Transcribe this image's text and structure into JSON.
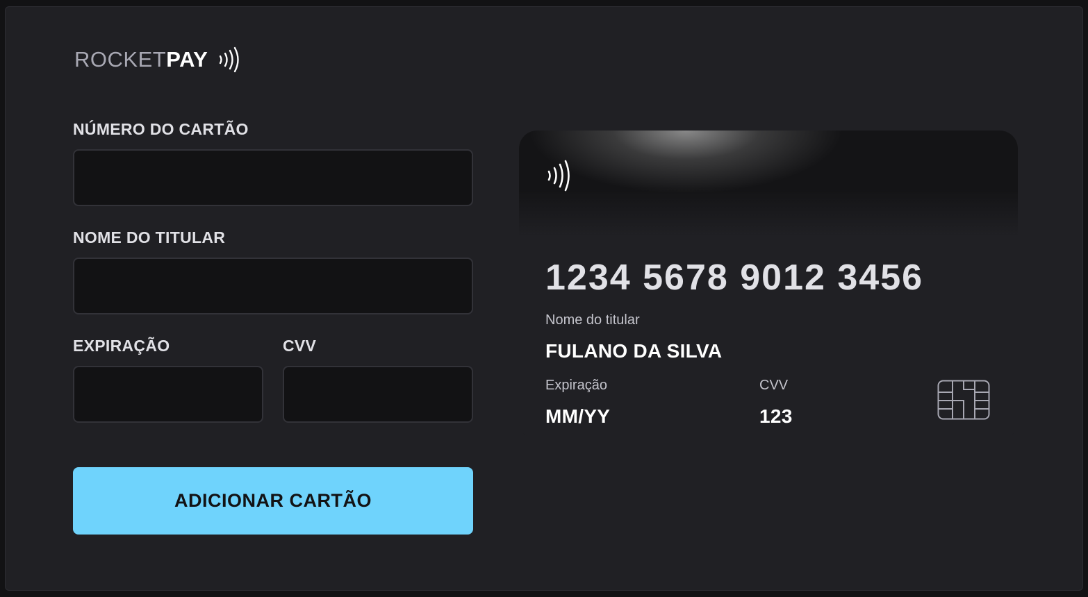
{
  "brand": {
    "name_light": "ROCKET",
    "name_bold": "PAY",
    "icon": "contactless-icon"
  },
  "form": {
    "card_number_label": "NÚMERO DO CARTÃO",
    "card_number_value": "",
    "holder_name_label": "NOME DO TITULAR",
    "holder_name_value": "",
    "expiration_label": "EXPIRAÇÃO",
    "expiration_value": "",
    "cvv_label": "CVV",
    "cvv_value": "",
    "submit_label": "ADICIONAR CARTÃO"
  },
  "card_preview": {
    "number": "1234 5678 9012 3456",
    "holder_label": "Nome do titular",
    "holder_value": "FULANO DA SILVA",
    "expiration_label": "Expiração",
    "expiration_value": "MM/YY",
    "cvv_label": "CVV",
    "cvv_value": "123",
    "icons": [
      "contactless-icon",
      "chip-icon"
    ]
  },
  "colors": {
    "background": "#121214",
    "panel": "#202024",
    "input": "#121214",
    "input_border": "#323238",
    "accent": "#6fd3fc",
    "text": "#e1e1e6"
  }
}
